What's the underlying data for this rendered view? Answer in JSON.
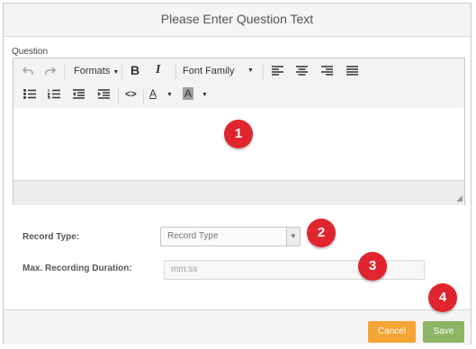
{
  "dialog": {
    "title": "Please Enter Question Text"
  },
  "editor": {
    "label": "Question",
    "toolbar": {
      "formats_label": "Formats",
      "font_family_label": "Font Family",
      "bold_glyph": "B",
      "italic_glyph": "I",
      "code_glyph": "<>",
      "text_color_glyph": "A",
      "bg_color_glyph": "A"
    }
  },
  "form": {
    "record_type_label": "Record Type:",
    "record_type_placeholder": "Record Type",
    "max_duration_label": "Max. Recording Duration:",
    "max_duration_placeholder": "mm:ss"
  },
  "footer": {
    "cancel_label": "Cancel",
    "save_label": "Save"
  },
  "badges": [
    "1",
    "2",
    "3",
    "4"
  ],
  "colors": {
    "badge": "#e0252f",
    "cancel": "#f4a533",
    "save": "#8db563"
  }
}
